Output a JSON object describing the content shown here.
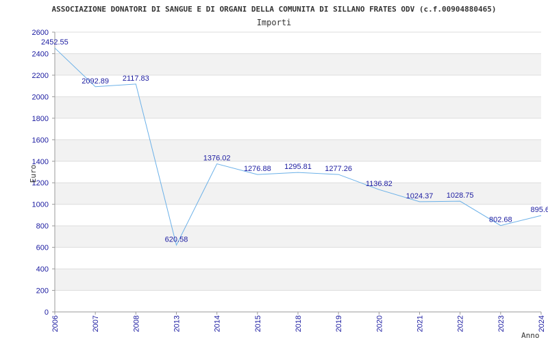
{
  "chart_data": {
    "type": "line",
    "title": "ASSOCIAZIONE DONATORI DI SANGUE E DI ORGANI DELLA COMUNITA DI SILLANO FRATES ODV (c.f.00904880465)",
    "subtitle": "Importi",
    "xlabel": "Anno",
    "ylabel": "Euro",
    "categories": [
      "2006",
      "2007",
      "2008",
      "2013",
      "2014",
      "2015",
      "2018",
      "2019",
      "2020",
      "2021",
      "2022",
      "2023",
      "2024"
    ],
    "values": [
      2452.55,
      2092.89,
      2117.83,
      620.58,
      1376.02,
      1276.88,
      1295.81,
      1277.26,
      1136.82,
      1024.37,
      1028.75,
      802.68,
      895.6
    ],
    "value_labels": [
      "2452.55",
      "2092.89",
      "2117.83",
      "620.58",
      "1376.02",
      "1276.88",
      "1295.81",
      "1277.26",
      "1136.82",
      "1024.37",
      "1028.75",
      "802.68",
      "895.6"
    ],
    "ylim": [
      0,
      2600
    ],
    "yticks": [
      0,
      200,
      400,
      600,
      800,
      1000,
      1200,
      1400,
      1600,
      1800,
      2000,
      2200,
      2400,
      2600
    ],
    "grid": true,
    "legend": "none",
    "colors": {
      "line": "#6ab0e8",
      "band": "#f2f2f2",
      "grid": "#dddddd",
      "tick_text": "#1a1aa0",
      "axis": "#999999"
    }
  }
}
